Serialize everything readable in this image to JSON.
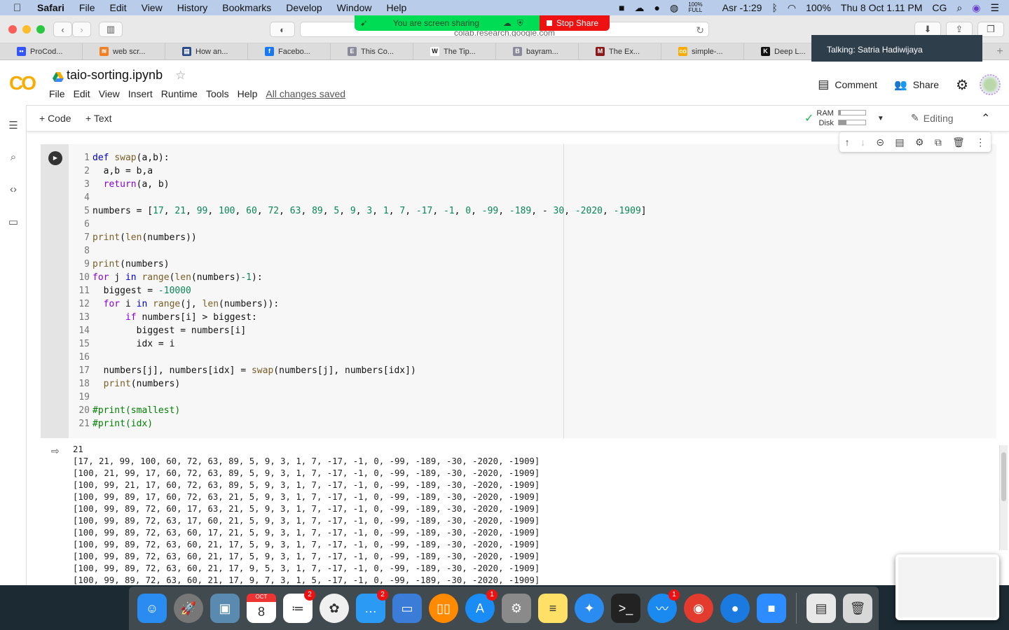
{
  "menubar": {
    "app": "Safari",
    "items": [
      "File",
      "Edit",
      "View",
      "History",
      "Bookmarks",
      "Develop",
      "Window",
      "Help"
    ],
    "status": {
      "battery_widget_top": "100%",
      "battery_widget_bottom": "FULL",
      "prayer": "Asr -1:29",
      "battery": "100%",
      "datetime": "Thu 8 Oct  1.11 PM",
      "user": "CG"
    }
  },
  "browser": {
    "url": "colab.research.google.com",
    "screen_share": {
      "label": "You are screen sharing",
      "stop_label": "Stop Share"
    },
    "talking": "Talking: Satria Hadiwijaya",
    "bookmarks": [
      {
        "label": "ProCod...",
        "color": "#3355ff",
        "glyph": "••"
      },
      {
        "label": "web scr...",
        "color": "#f48024",
        "glyph": "≋"
      },
      {
        "label": "How an...",
        "color": "#2b4a8a",
        "glyph": "▤"
      },
      {
        "label": "Facebo...",
        "color": "#1877f2",
        "glyph": "f"
      },
      {
        "label": "This Co...",
        "color": "#8a8a9a",
        "glyph": "E"
      },
      {
        "label": "The Tip...",
        "color": "#ffffff",
        "glyph": "W"
      },
      {
        "label": "bayram...",
        "color": "#8a8a9a",
        "glyph": "B"
      },
      {
        "label": "The Ex...",
        "color": "#8a1a1a",
        "glyph": "M"
      },
      {
        "label": "simple-...",
        "color": "#f9ab00",
        "glyph": "co"
      },
      {
        "label": "Deep L...",
        "color": "#111111",
        "glyph": "K"
      }
    ]
  },
  "colab": {
    "logo": "CO",
    "notebook_title": "taio-sorting.ipynb",
    "menus": [
      "File",
      "Edit",
      "View",
      "Insert",
      "Runtime",
      "Tools",
      "Help"
    ],
    "save_status": "All changes saved",
    "comment_label": "Comment",
    "share_label": "Share",
    "add_code": "+ Code",
    "add_text": "+ Text",
    "ram_label": "RAM",
    "disk_label": "Disk",
    "ram_usage": 0.08,
    "disk_usage": 0.3,
    "mode_label": "Editing"
  },
  "cell": {
    "lines": [
      "def swap(a,b):",
      "  a,b = b,a",
      "  return(a, b)",
      "",
      "numbers = [17, 21, 99, 100, 60, 72, 63, 89, 5, 9, 3, 1, 7, -17, -1, 0, -99, -189, - 30, -2020, -1909]",
      "",
      "print(len(numbers))",
      "",
      "print(numbers)",
      "for j in range(len(numbers)-1):",
      "  biggest = -10000",
      "  for i in range(j, len(numbers)):",
      "      if numbers[i] > biggest:",
      "        biggest = numbers[i]",
      "        idx = i",
      "",
      "  numbers[j], numbers[idx] = swap(numbers[j], numbers[idx])",
      "  print(numbers)",
      "",
      "#print(smallest)",
      "#print(idx)"
    ]
  },
  "output": {
    "lines": [
      "21",
      "[17, 21, 99, 100, 60, 72, 63, 89, 5, 9, 3, 1, 7, -17, -1, 0, -99, -189, -30, -2020, -1909]",
      "[100, 21, 99, 17, 60, 72, 63, 89, 5, 9, 3, 1, 7, -17, -1, 0, -99, -189, -30, -2020, -1909]",
      "[100, 99, 21, 17, 60, 72, 63, 89, 5, 9, 3, 1, 7, -17, -1, 0, -99, -189, -30, -2020, -1909]",
      "[100, 99, 89, 17, 60, 72, 63, 21, 5, 9, 3, 1, 7, -17, -1, 0, -99, -189, -30, -2020, -1909]",
      "[100, 99, 89, 72, 60, 17, 63, 21, 5, 9, 3, 1, 7, -17, -1, 0, -99, -189, -30, -2020, -1909]",
      "[100, 99, 89, 72, 63, 17, 60, 21, 5, 9, 3, 1, 7, -17, -1, 0, -99, -189, -30, -2020, -1909]",
      "[100, 99, 89, 72, 63, 60, 17, 21, 5, 9, 3, 1, 7, -17, -1, 0, -99, -189, -30, -2020, -1909]",
      "[100, 99, 89, 72, 63, 60, 21, 17, 5, 9, 3, 1, 7, -17, -1, 0, -99, -189, -30, -2020, -1909]",
      "[100, 99, 89, 72, 63, 60, 21, 17, 5, 9, 3, 1, 7, -17, -1, 0, -99, -189, -30, -2020, -1909]",
      "[100, 99, 89, 72, 63, 60, 21, 17, 9, 5, 3, 1, 7, -17, -1, 0, -99, -189, -30, -2020, -1909]",
      "[100, 99, 89, 72, 63, 60, 21, 17, 9, 7, 3, 1, 5, -17, -1, 0, -99, -189, -30, -2020, -1909]"
    ]
  },
  "dock": {
    "apps": [
      {
        "name": "finder",
        "color": "#2a8cf0",
        "glyph": "☺",
        "badge": null
      },
      {
        "name": "launchpad",
        "color": "#777777",
        "glyph": "🚀",
        "badge": null
      },
      {
        "name": "preview",
        "color": "#5a8ab0",
        "glyph": "▣",
        "badge": null
      },
      {
        "name": "calendar",
        "color": "#ffffff",
        "glyph": "8",
        "badge": null,
        "top": "OCT"
      },
      {
        "name": "reminders",
        "color": "#ffffff",
        "glyph": "≔",
        "badge": "2"
      },
      {
        "name": "photos",
        "color": "#f0f0f0",
        "glyph": "✿",
        "badge": null
      },
      {
        "name": "messages",
        "color": "#2a9af5",
        "glyph": "…",
        "badge": "2"
      },
      {
        "name": "keynote",
        "color": "#3a7cd8",
        "glyph": "▭",
        "badge": null
      },
      {
        "name": "books",
        "color": "#ff8a00",
        "glyph": "▯▯",
        "badge": null
      },
      {
        "name": "app-store",
        "color": "#1a8cf5",
        "glyph": "A",
        "badge": "1"
      },
      {
        "name": "system-preferences",
        "color": "#8a8a8a",
        "glyph": "⚙",
        "badge": null
      },
      {
        "name": "notes",
        "color": "#ffe066",
        "glyph": "≡",
        "badge": null
      },
      {
        "name": "safari",
        "color": "#2a8cf0",
        "glyph": "✦",
        "badge": null
      },
      {
        "name": "terminal",
        "color": "#222222",
        "glyph": ">_",
        "badge": null
      },
      {
        "name": "mustache-app",
        "color": "#1a8af0",
        "glyph": "〰",
        "badge": "1"
      },
      {
        "name": "chrome",
        "color": "#e33b2e",
        "glyph": "◉",
        "badge": null
      },
      {
        "name": "chat-bubble",
        "color": "#1a7ae0",
        "glyph": "●",
        "badge": null
      },
      {
        "name": "zoom",
        "color": "#2d8cff",
        "glyph": "■",
        "badge": null
      }
    ],
    "trailing": [
      {
        "name": "documents-stack",
        "color": "#e8e8e8",
        "glyph": "▤"
      },
      {
        "name": "trash",
        "color": "#d8d8d8",
        "glyph": "🗑"
      }
    ]
  }
}
